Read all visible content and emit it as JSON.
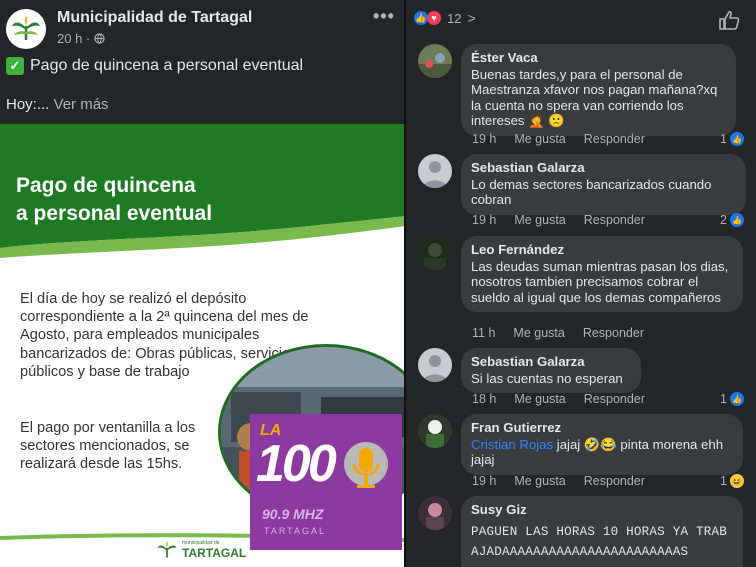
{
  "post": {
    "page_name": "Municipalidad de Tartagal",
    "time": "20 h",
    "privacy_icon": "globe-icon",
    "more_icon": "•••",
    "line1": "Pago de quincena a personal eventual",
    "line2_prefix": "Hoy:...",
    "see_more": "Ver más"
  },
  "card": {
    "title": "Pago de quincena\na personal eventual",
    "body1": "El día de hoy se realizó el depósito correspondiente a la 2ª quincena del mes de Agosto, para empleados municipales bancarizados de: Obras públicas, servicios públicos y base de trabajo",
    "body2": "El pago por ventanilla a los sectores mencionados, se realizará desde las 15hs.",
    "footer_small": "municipalidad de",
    "footer_big": "TARTAGAL",
    "colors": {
      "green": "#1e7a23",
      "light_green": "#79b94d"
    }
  },
  "radio": {
    "la": "LA",
    "number": "100",
    "freq": "90.9 MHZ",
    "city": "TARTAGAL"
  },
  "reactions": {
    "count": "12",
    "chevron": ">"
  },
  "comments": [
    {
      "author": "Éster Vaca",
      "text": "Buenas tardes,y para el personal de Maestranza xfavor nos pagan mañana?xq la cuenta no spera van corriendo los intereses 🤦 🙁",
      "time": "19 h",
      "like": "Me gusta",
      "reply": "Responder",
      "likes": "1"
    },
    {
      "author": "Sebastian Galarza",
      "text": "Lo demas sectores bancarizados cuando cobran",
      "time": "19 h",
      "like": "Me gusta",
      "reply": "Responder",
      "likes": "2"
    },
    {
      "author": "Leo Fernández",
      "text": "Las deudas suman mientras pasan los dias, nosotros tambien precisamos cobrar el sueldo al igual que los demas compañeros",
      "time": "11 h",
      "like": "Me gusta",
      "reply": "Responder",
      "likes": ""
    },
    {
      "author": "Sebastian Galarza",
      "text": "Si las cuentas no esperan",
      "time": "18 h",
      "like": "Me gusta",
      "reply": "Responder",
      "likes": "1"
    },
    {
      "author": "Fran Gutierrez",
      "mention": "Cristian Rojas",
      "text": " jajaj 🤣😂 pinta morena ehh jajaj",
      "time": "19 h",
      "like": "Me gusta",
      "reply": "Responder",
      "likes": "1"
    },
    {
      "author": "Susy Giz",
      "text": "PAGUEN LAS HORAS 10 HORAS YA TRABAJADAAAAAAAAAAAAAAAAAAAAAAAS"
    }
  ]
}
